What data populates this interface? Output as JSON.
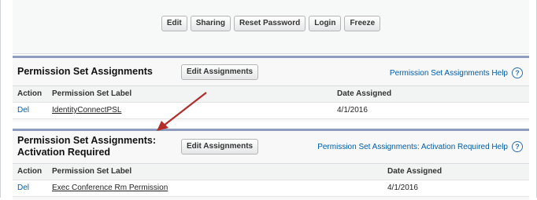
{
  "toolbar": {
    "buttons": [
      "Edit",
      "Sharing",
      "Reset Password",
      "Login",
      "Freeze"
    ]
  },
  "permission_set_assignments": {
    "title": "Permission Set Assignments",
    "edit_button": "Edit Assignments",
    "help_link": "Permission Set Assignments Help",
    "help_icon": "?",
    "columns": [
      "Action",
      "Permission Set Label",
      "Date Assigned"
    ],
    "rows": [
      {
        "action": "Del",
        "label": "IdentityConnectPSL",
        "date": "4/1/2016"
      }
    ]
  },
  "activation_required": {
    "title": "Permission Set Assignments: Activation Required",
    "edit_button": "Edit Assignments",
    "help_link": "Permission Set Assignments: Activation Required Help",
    "help_icon": "?",
    "columns": [
      "Action",
      "Permission Set Label",
      "Date Assigned"
    ],
    "rows": [
      {
        "action": "Del",
        "label": "Exec Conference Rm Permission",
        "date": "4/1/2016"
      }
    ]
  },
  "annotation": {
    "arrow_color": "#b22e2a",
    "icon": "annotation-arrow-icon"
  }
}
